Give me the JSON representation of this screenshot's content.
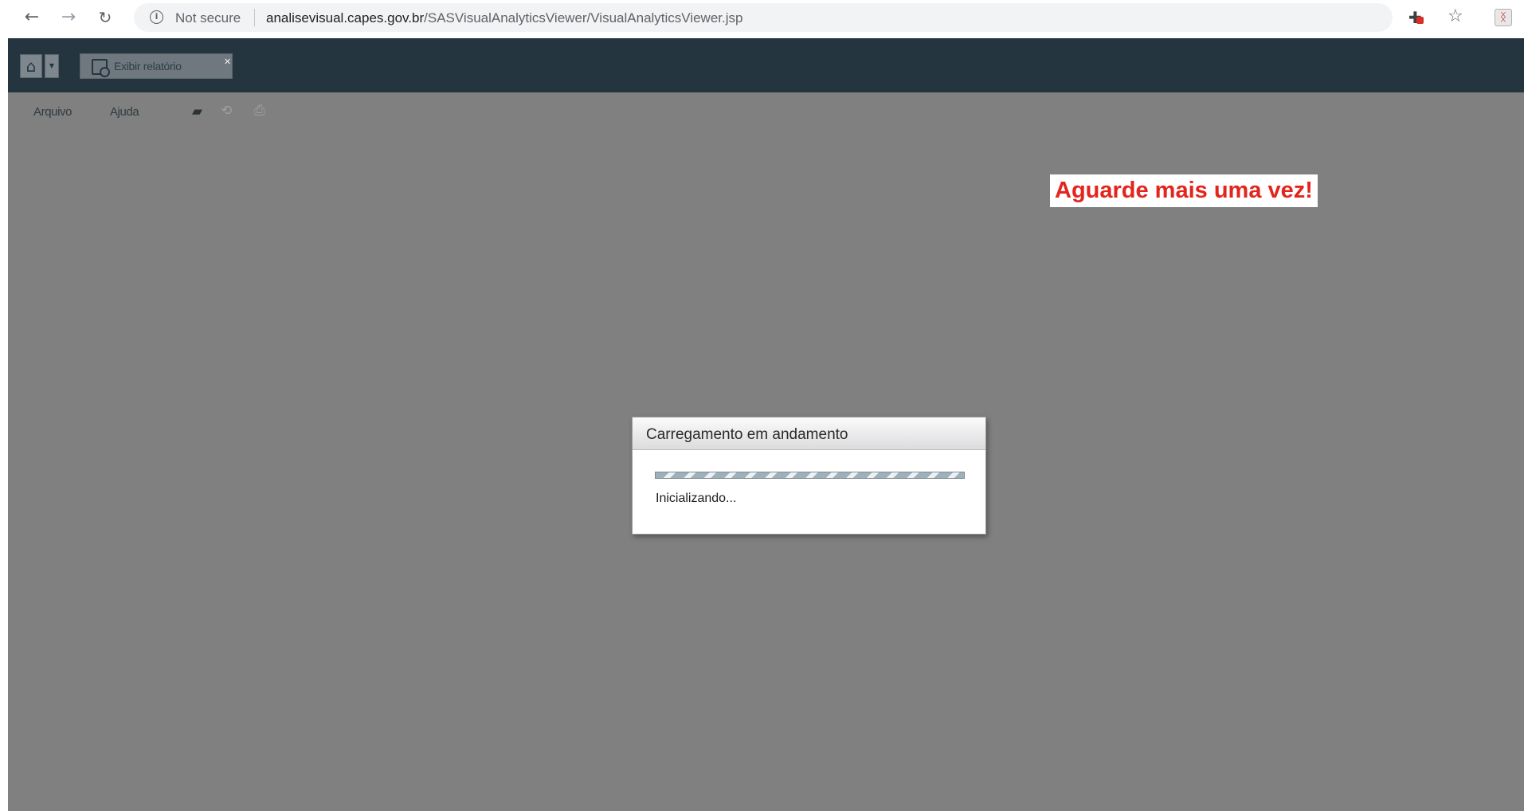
{
  "browser": {
    "back_icon": "arrow-left-icon",
    "forward_icon": "arrow-right-icon",
    "reload_icon": "reload-icon",
    "security_label": "Not secure",
    "url_host": "analisevisual.capes.gov.br",
    "url_path": "/SASVisualAnalyticsViewer/VisualAnalyticsViewer.jsp"
  },
  "app": {
    "report_tab_label": "Exibir relatório",
    "menu": {
      "file": "Arquivo",
      "help": "Ajuda"
    },
    "colors": {
      "header_bg": "#25353f",
      "workspace_bg": "#808080"
    }
  },
  "annotation": {
    "text": "Aguarde mais uma vez!",
    "color": "#e2251d"
  },
  "loading_dialog": {
    "title": "Carregamento em andamento",
    "status": "Inicializando...",
    "progress": "indeterminate"
  }
}
